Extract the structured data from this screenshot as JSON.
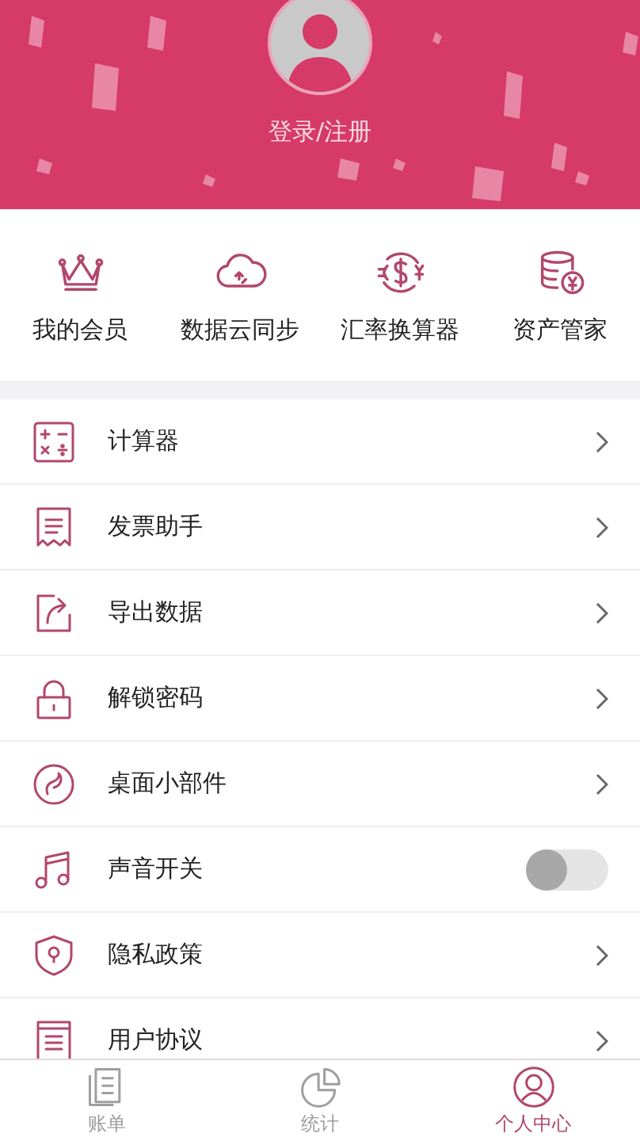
{
  "profile": {
    "login_label": "登录/注册"
  },
  "shortcuts": [
    {
      "label": "我的会员"
    },
    {
      "label": "数据云同步"
    },
    {
      "label": "汇率换算器"
    },
    {
      "label": "资产管家"
    }
  ],
  "menu": [
    {
      "kind": "link",
      "label": "计算器"
    },
    {
      "kind": "link",
      "label": "发票助手"
    },
    {
      "kind": "link",
      "label": "导出数据"
    },
    {
      "kind": "link",
      "label": "解锁密码"
    },
    {
      "kind": "link",
      "label": "桌面小部件"
    },
    {
      "kind": "switch",
      "label": "声音开关",
      "on": false
    },
    {
      "kind": "link",
      "label": "隐私政策"
    },
    {
      "kind": "link",
      "label": "用户协议"
    }
  ],
  "tab_bar": [
    {
      "label": "账单",
      "selected": false
    },
    {
      "label": "统计",
      "selected": false
    },
    {
      "label": "个人中心",
      "selected": true
    }
  ]
}
